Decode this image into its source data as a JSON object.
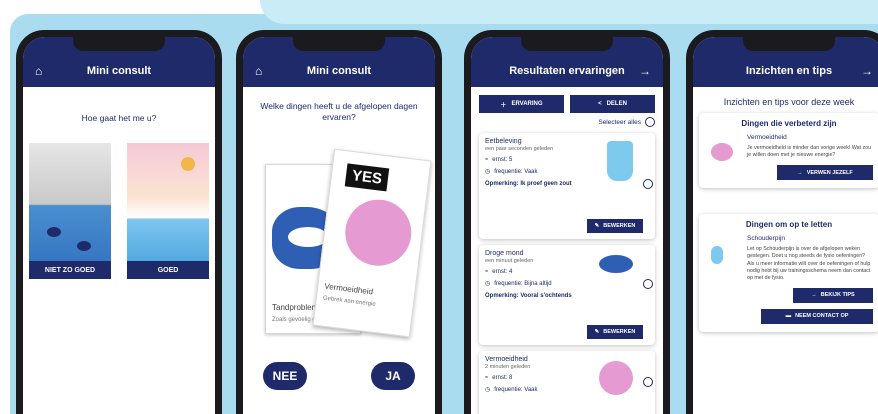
{
  "phone1": {
    "title": "Mini consult",
    "question": "Hoe gaat het me u?",
    "option_left": "NIET ZO GOED",
    "option_right": "GOED"
  },
  "phone2": {
    "title": "Mini consult",
    "question": "Welke dingen heeft u de afgelopen dagen ervaren?",
    "card_back_title": "Tandproblem",
    "card_back_sub": "Zoals gevoelig gebit, pijn",
    "card_front_title": "Vermoeidheid",
    "card_front_sub": "Gebrek aan energie",
    "yes_tag": "YES",
    "no_button": "NEE",
    "yes_button": "JA"
  },
  "phone3": {
    "title": "Resultaten ervaringen",
    "add_button": "ERVARING",
    "share_button": "DELEN",
    "select_all": "Selecteer alles",
    "edit_label": "BEWERKEN",
    "items": [
      {
        "title": "Eetbeleving",
        "time": "een paar seconden geleden",
        "ernst": "ernst: 5",
        "frequentie": "frequentie: Vaak",
        "note": "Opmerking: Ik proef geen zout"
      },
      {
        "title": "Droge mond",
        "time": "een minuut geleden",
        "ernst": "ernst: 4",
        "frequentie": "frequentie: Bijna altijd",
        "note": "Opmerking: Vooral s'ochtends"
      },
      {
        "title": "Vermoeidheid",
        "time": "2 minuten geleden",
        "ernst": "ernst: 8",
        "frequentie": "frequentie: Vaak",
        "note": ""
      }
    ]
  },
  "phone4": {
    "title": "Inzichten en tips",
    "heading": "Inzichten en tips voor deze week",
    "improved": {
      "title": "Dingen die verbeterd zijn",
      "subtitle": "Vermoeidheid",
      "body": "Je vermoeidheid is minder dan vorige week! Wat zou je willen doen met je nieuwe energie?",
      "button": "VERWEN JEZELF"
    },
    "attention": {
      "title": "Dingen om op te letten",
      "subtitle": "Schouderpijn",
      "body": "Let op Schouderpijn is over de afgelopen weken gestegen. Doet u nog steeds de fysio oefeningen? Als u meer informatie wilt over de oefeningen of hulp nodig hebt bij uw trainingsschema neem dan contact op met de fysio.",
      "button_tips": "BEKIJK TIPS",
      "button_contact": "NEEM CONTACT OP"
    }
  },
  "colors": {
    "navy": "#1f2a6b",
    "sky": "#a8dcee",
    "pink": "#e59bd2",
    "blue": "#2e5fb5"
  }
}
